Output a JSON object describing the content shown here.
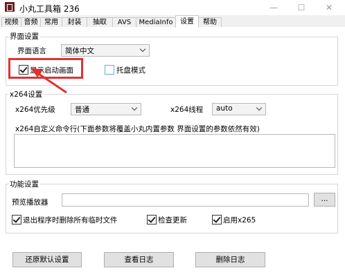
{
  "window": {
    "title": "小丸工具箱 236"
  },
  "titlebar": {
    "minimize": "—",
    "maximize": "☐",
    "close": "✕"
  },
  "tabs": [
    "视频",
    "音频",
    "常用",
    "封装",
    "抽取",
    "AVS",
    "MediaInfo",
    "设置",
    "帮助"
  ],
  "active_tab": "设置",
  "ui_settings": {
    "title": "界面设置",
    "language_label": "界面语言",
    "language_value": "简体中文",
    "show_splash_label": "显示启动画面",
    "show_splash_checked": true,
    "tray_mode_label": "托盘模式",
    "tray_mode_checked": false
  },
  "x264_settings": {
    "title": "x264设置",
    "priority_label": "x264优先级",
    "priority_value": "普通",
    "threads_label": "x264线程",
    "threads_value": "auto",
    "custom_cmd_label": "x264自定义命令行(下面参数将覆盖小丸内置参数 界面设置的参数依然有效)",
    "custom_cmd_value": ""
  },
  "function_settings": {
    "title": "功能设置",
    "preview_player_label": "预览播放器",
    "preview_player_value": "",
    "browse_label": "...",
    "delete_temp_label": "退出程序时删除所有临时文件",
    "delete_temp_checked": true,
    "check_update_label": "检查更新",
    "check_update_checked": true,
    "enable_x265_label": "启用x265",
    "enable_x265_checked": true
  },
  "buttons": {
    "restore_defaults": "还原默认设置",
    "view_log": "查看日志",
    "delete_log": "删除日志"
  },
  "annotation_color": "#e03131"
}
